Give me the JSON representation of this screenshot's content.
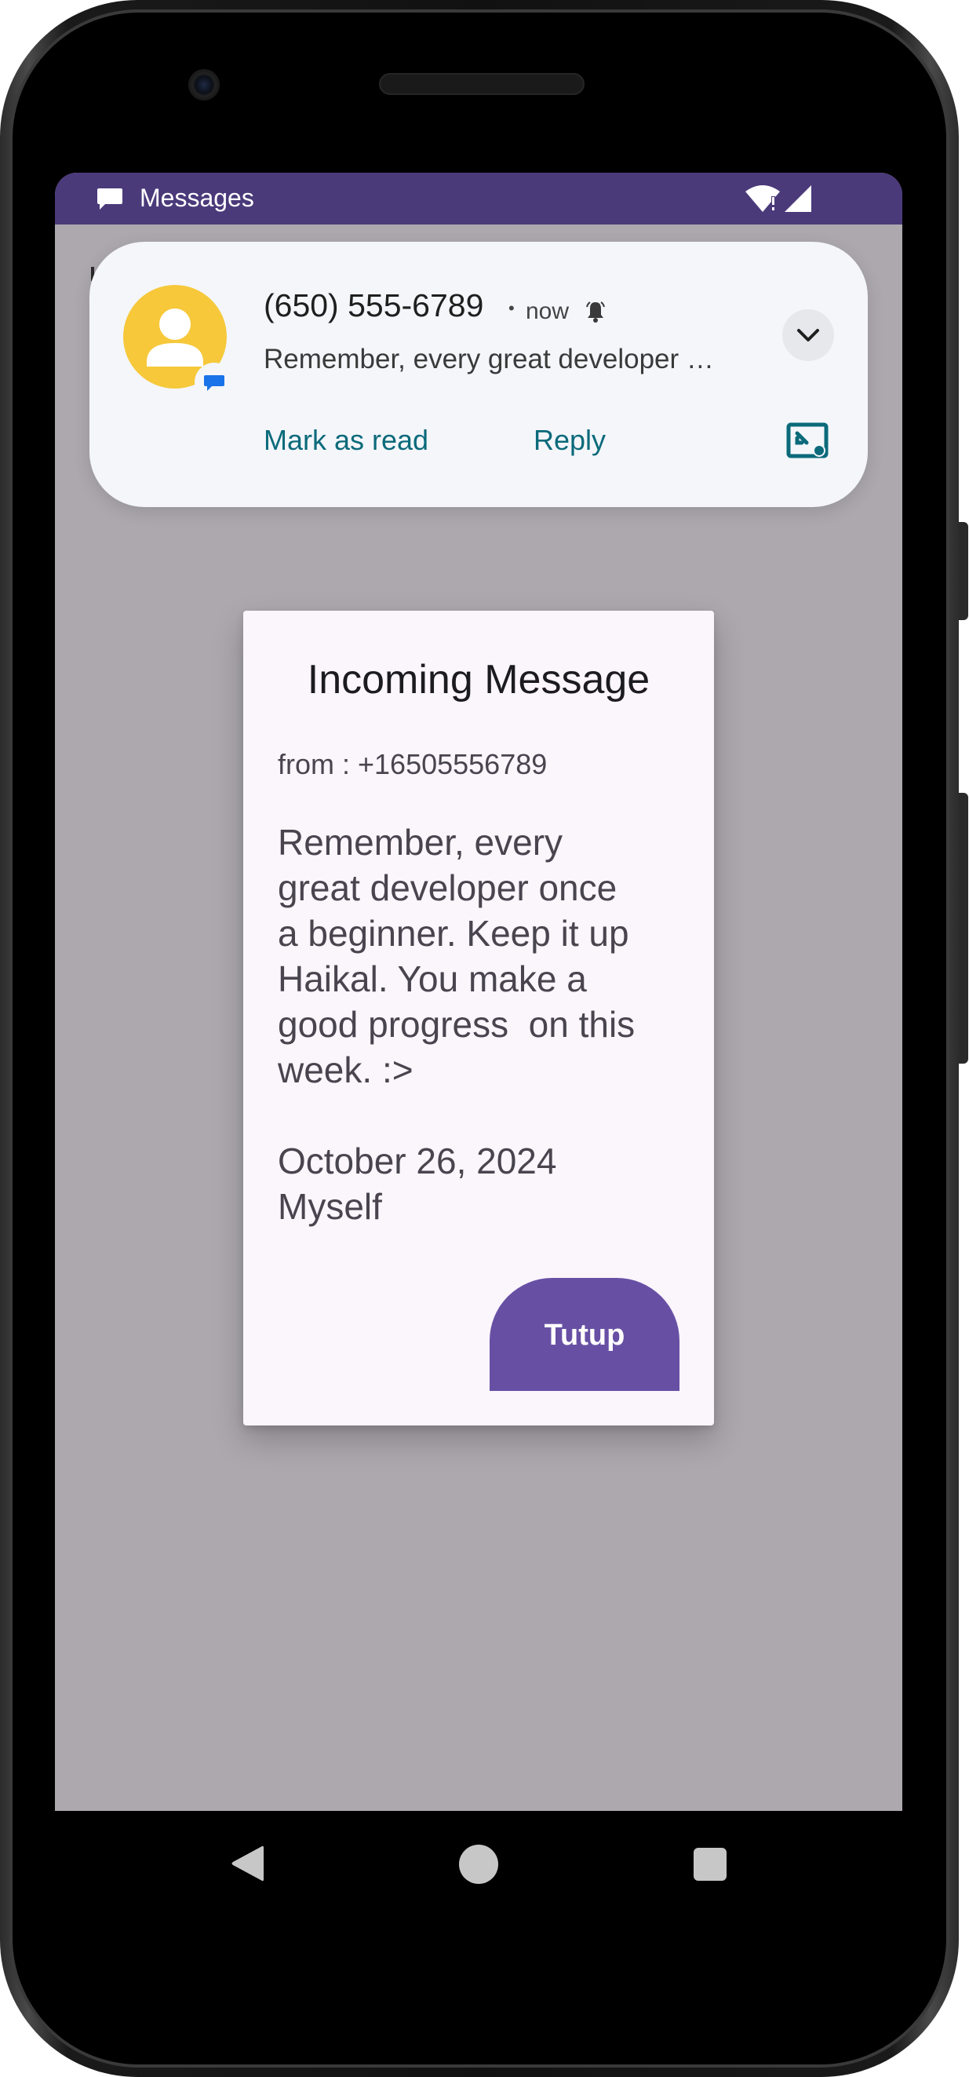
{
  "status_bar": {
    "app_label": "Messages",
    "background": "#4a3a7a"
  },
  "notification": {
    "sender": "(650) 555-6789",
    "separator": "•",
    "time": "now",
    "preview": "Remember, every great developer …",
    "actions": {
      "mark_as_read": "Mark as read",
      "reply": "Reply"
    },
    "avatar_color": "#f6c83a",
    "action_color": "#0b6a7a",
    "icons": {
      "avatar": "person-icon",
      "app_badge": "messages-badge-icon",
      "bell": "bell-icon",
      "expand": "chevron-down-icon",
      "bubble": "open-bubble-icon"
    }
  },
  "dialog": {
    "title": "Incoming Message",
    "from": "from : +16505556789",
    "body": "Remember, every\ngreat developer once\na beginner. Keep it up\nHaikal. You make a\ngood progress  on this\nweek. :>",
    "date": "October 26, 2024",
    "signature": "Myself",
    "close_button": "Tutup",
    "button_color": "#6750a4"
  },
  "nav_bar": {
    "icons": [
      "back-icon",
      "home-icon",
      "recents-icon"
    ]
  }
}
